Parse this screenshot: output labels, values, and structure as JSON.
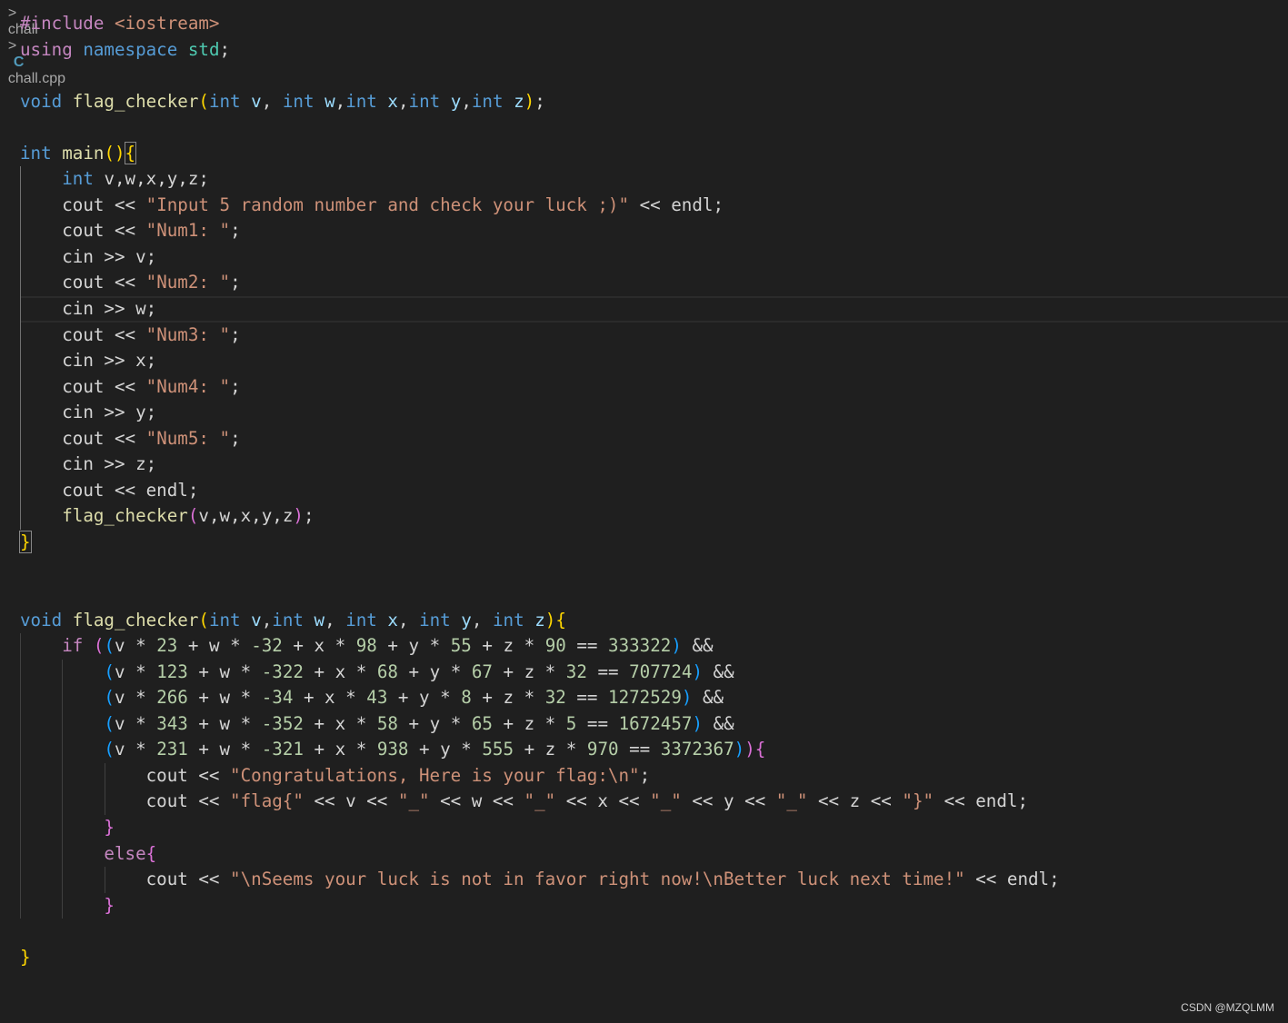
{
  "breadcrumb": {
    "folder": "chall",
    "separator": ">",
    "file": "chall.cpp"
  },
  "code": {
    "lines": [
      [
        {
          "t": "#include ",
          "c": "k-pp"
        },
        {
          "t": "<iostream>",
          "c": "str"
        }
      ],
      [
        {
          "t": "using ",
          "c": "k-purple"
        },
        {
          "t": "namespace ",
          "c": "k-blue"
        },
        {
          "t": "std",
          "c": "ty"
        },
        {
          "t": ";",
          "c": "txt"
        }
      ],
      [],
      [
        {
          "t": "void ",
          "c": "k-blue"
        },
        {
          "t": "flag_checker",
          "c": "fn"
        },
        {
          "t": "(",
          "c": "b1"
        },
        {
          "t": "int ",
          "c": "k-blue"
        },
        {
          "t": "v",
          "c": "var"
        },
        {
          "t": ", ",
          "c": "txt"
        },
        {
          "t": "int ",
          "c": "k-blue"
        },
        {
          "t": "w",
          "c": "var"
        },
        {
          "t": ",",
          "c": "txt"
        },
        {
          "t": "int ",
          "c": "k-blue"
        },
        {
          "t": "x",
          "c": "var"
        },
        {
          "t": ",",
          "c": "txt"
        },
        {
          "t": "int ",
          "c": "k-blue"
        },
        {
          "t": "y",
          "c": "var"
        },
        {
          "t": ",",
          "c": "txt"
        },
        {
          "t": "int ",
          "c": "k-blue"
        },
        {
          "t": "z",
          "c": "var"
        },
        {
          "t": ")",
          "c": "b1"
        },
        {
          "t": ";",
          "c": "txt"
        }
      ],
      [],
      [
        {
          "t": "int ",
          "c": "k-blue"
        },
        {
          "t": "main",
          "c": "fn"
        },
        {
          "t": "()",
          "c": "b1"
        },
        {
          "t": "{",
          "c": "b1 bm"
        }
      ],
      [
        {
          "t": "    "
        },
        {
          "t": "int ",
          "c": "k-blue"
        },
        {
          "t": "v,w,x,y,z;",
          "c": "txt"
        }
      ],
      [
        {
          "t": "    "
        },
        {
          "t": "cout ",
          "c": "txt"
        },
        {
          "t": "<< ",
          "c": "txt"
        },
        {
          "t": "\"Input 5 random number and check your luck ;)\"",
          "c": "str"
        },
        {
          "t": " << endl;",
          "c": "txt"
        }
      ],
      [
        {
          "t": "    "
        },
        {
          "t": "cout ",
          "c": "txt"
        },
        {
          "t": "<< ",
          "c": "txt"
        },
        {
          "t": "\"Num1: \"",
          "c": "str"
        },
        {
          "t": ";",
          "c": "txt"
        }
      ],
      [
        {
          "t": "    "
        },
        {
          "t": "cin >> v;",
          "c": "txt"
        }
      ],
      [
        {
          "t": "    "
        },
        {
          "t": "cout ",
          "c": "txt"
        },
        {
          "t": "<< ",
          "c": "txt"
        },
        {
          "t": "\"Num2: \"",
          "c": "str"
        },
        {
          "t": ";",
          "c": "txt"
        }
      ],
      [
        {
          "t": "    "
        },
        {
          "t": "cin >> w;",
          "c": "txt"
        }
      ],
      [
        {
          "t": "    "
        },
        {
          "t": "cout ",
          "c": "txt"
        },
        {
          "t": "<< ",
          "c": "txt"
        },
        {
          "t": "\"Num3: \"",
          "c": "str"
        },
        {
          "t": ";",
          "c": "txt"
        }
      ],
      [
        {
          "t": "    "
        },
        {
          "t": "cin >> x;",
          "c": "txt"
        }
      ],
      [
        {
          "t": "    "
        },
        {
          "t": "cout ",
          "c": "txt"
        },
        {
          "t": "<< ",
          "c": "txt"
        },
        {
          "t": "\"Num4: \"",
          "c": "str"
        },
        {
          "t": ";",
          "c": "txt"
        }
      ],
      [
        {
          "t": "    "
        },
        {
          "t": "cin >> y;",
          "c": "txt"
        }
      ],
      [
        {
          "t": "    "
        },
        {
          "t": "cout ",
          "c": "txt"
        },
        {
          "t": "<< ",
          "c": "txt"
        },
        {
          "t": "\"Num5: \"",
          "c": "str"
        },
        {
          "t": ";",
          "c": "txt"
        }
      ],
      [
        {
          "t": "    "
        },
        {
          "t": "cin >> z;",
          "c": "txt"
        }
      ],
      [
        {
          "t": "    "
        },
        {
          "t": "cout << endl;",
          "c": "txt"
        }
      ],
      [
        {
          "t": "    "
        },
        {
          "t": "flag_checker",
          "c": "fn"
        },
        {
          "t": "(",
          "c": "b2"
        },
        {
          "t": "v,w,x,y,z",
          "c": "txt"
        },
        {
          "t": ")",
          "c": "b2"
        },
        {
          "t": ";",
          "c": "txt"
        }
      ],
      [
        {
          "t": "}",
          "c": "b1 bm"
        }
      ],
      [],
      [],
      [
        {
          "t": "void ",
          "c": "k-blue"
        },
        {
          "t": "flag_checker",
          "c": "fn"
        },
        {
          "t": "(",
          "c": "b1"
        },
        {
          "t": "int ",
          "c": "k-blue"
        },
        {
          "t": "v",
          "c": "var"
        },
        {
          "t": ",",
          "c": "txt"
        },
        {
          "t": "int ",
          "c": "k-blue"
        },
        {
          "t": "w",
          "c": "var"
        },
        {
          "t": ", ",
          "c": "txt"
        },
        {
          "t": "int ",
          "c": "k-blue"
        },
        {
          "t": "x",
          "c": "var"
        },
        {
          "t": ", ",
          "c": "txt"
        },
        {
          "t": "int ",
          "c": "k-blue"
        },
        {
          "t": "y",
          "c": "var"
        },
        {
          "t": ", ",
          "c": "txt"
        },
        {
          "t": "int ",
          "c": "k-blue"
        },
        {
          "t": "z",
          "c": "var"
        },
        {
          "t": ")",
          "c": "b1"
        },
        {
          "t": "{",
          "c": "b1"
        }
      ],
      [
        {
          "t": "    "
        },
        {
          "t": "if ",
          "c": "k-purple"
        },
        {
          "t": "(",
          "c": "b2"
        },
        {
          "t": "(",
          "c": "b3"
        },
        {
          "t": "v * ",
          "c": "txt"
        },
        {
          "t": "23",
          "c": "num"
        },
        {
          "t": " + w * ",
          "c": "txt"
        },
        {
          "t": "-32",
          "c": "num"
        },
        {
          "t": " + x * ",
          "c": "txt"
        },
        {
          "t": "98",
          "c": "num"
        },
        {
          "t": " + y * ",
          "c": "txt"
        },
        {
          "t": "55",
          "c": "num"
        },
        {
          "t": " + z * ",
          "c": "txt"
        },
        {
          "t": "90",
          "c": "num"
        },
        {
          "t": " == ",
          "c": "txt"
        },
        {
          "t": "333322",
          "c": "num"
        },
        {
          "t": ")",
          "c": "b3"
        },
        {
          "t": " &&",
          "c": "txt"
        }
      ],
      [
        {
          "t": "        "
        },
        {
          "t": "(",
          "c": "b3"
        },
        {
          "t": "v * ",
          "c": "txt"
        },
        {
          "t": "123",
          "c": "num"
        },
        {
          "t": " + w * ",
          "c": "txt"
        },
        {
          "t": "-322",
          "c": "num"
        },
        {
          "t": " + x * ",
          "c": "txt"
        },
        {
          "t": "68",
          "c": "num"
        },
        {
          "t": " + y * ",
          "c": "txt"
        },
        {
          "t": "67",
          "c": "num"
        },
        {
          "t": " + z * ",
          "c": "txt"
        },
        {
          "t": "32",
          "c": "num"
        },
        {
          "t": " == ",
          "c": "txt"
        },
        {
          "t": "707724",
          "c": "num"
        },
        {
          "t": ")",
          "c": "b3"
        },
        {
          "t": " &&",
          "c": "txt"
        }
      ],
      [
        {
          "t": "        "
        },
        {
          "t": "(",
          "c": "b3"
        },
        {
          "t": "v * ",
          "c": "txt"
        },
        {
          "t": "266",
          "c": "num"
        },
        {
          "t": " + w * ",
          "c": "txt"
        },
        {
          "t": "-34",
          "c": "num"
        },
        {
          "t": " + x * ",
          "c": "txt"
        },
        {
          "t": "43",
          "c": "num"
        },
        {
          "t": " + y * ",
          "c": "txt"
        },
        {
          "t": "8",
          "c": "num"
        },
        {
          "t": " + z * ",
          "c": "txt"
        },
        {
          "t": "32",
          "c": "num"
        },
        {
          "t": " == ",
          "c": "txt"
        },
        {
          "t": "1272529",
          "c": "num"
        },
        {
          "t": ")",
          "c": "b3"
        },
        {
          "t": " &&",
          "c": "txt"
        }
      ],
      [
        {
          "t": "        "
        },
        {
          "t": "(",
          "c": "b3"
        },
        {
          "t": "v * ",
          "c": "txt"
        },
        {
          "t": "343",
          "c": "num"
        },
        {
          "t": " + w * ",
          "c": "txt"
        },
        {
          "t": "-352",
          "c": "num"
        },
        {
          "t": " + x * ",
          "c": "txt"
        },
        {
          "t": "58",
          "c": "num"
        },
        {
          "t": " + y * ",
          "c": "txt"
        },
        {
          "t": "65",
          "c": "num"
        },
        {
          "t": " + z * ",
          "c": "txt"
        },
        {
          "t": "5",
          "c": "num"
        },
        {
          "t": " == ",
          "c": "txt"
        },
        {
          "t": "1672457",
          "c": "num"
        },
        {
          "t": ")",
          "c": "b3"
        },
        {
          "t": " &&",
          "c": "txt"
        }
      ],
      [
        {
          "t": "        "
        },
        {
          "t": "(",
          "c": "b3"
        },
        {
          "t": "v * ",
          "c": "txt"
        },
        {
          "t": "231",
          "c": "num"
        },
        {
          "t": " + w * ",
          "c": "txt"
        },
        {
          "t": "-321",
          "c": "num"
        },
        {
          "t": " + x * ",
          "c": "txt"
        },
        {
          "t": "938",
          "c": "num"
        },
        {
          "t": " + y * ",
          "c": "txt"
        },
        {
          "t": "555",
          "c": "num"
        },
        {
          "t": " + z * ",
          "c": "txt"
        },
        {
          "t": "970",
          "c": "num"
        },
        {
          "t": " == ",
          "c": "txt"
        },
        {
          "t": "3372367",
          "c": "num"
        },
        {
          "t": ")",
          "c": "b3"
        },
        {
          "t": ")",
          "c": "b2"
        },
        {
          "t": "{",
          "c": "b2"
        }
      ],
      [
        {
          "t": "            "
        },
        {
          "t": "cout << ",
          "c": "txt"
        },
        {
          "t": "\"Congratulations, Here is your flag:\\n\"",
          "c": "str"
        },
        {
          "t": ";",
          "c": "txt"
        }
      ],
      [
        {
          "t": "            "
        },
        {
          "t": "cout << ",
          "c": "txt"
        },
        {
          "t": "\"flag{\"",
          "c": "str"
        },
        {
          "t": " << v << ",
          "c": "txt"
        },
        {
          "t": "\"_\"",
          "c": "str"
        },
        {
          "t": " << w << ",
          "c": "txt"
        },
        {
          "t": "\"_\"",
          "c": "str"
        },
        {
          "t": " << x << ",
          "c": "txt"
        },
        {
          "t": "\"_\"",
          "c": "str"
        },
        {
          "t": " << y << ",
          "c": "txt"
        },
        {
          "t": "\"_\"",
          "c": "str"
        },
        {
          "t": " << z << ",
          "c": "txt"
        },
        {
          "t": "\"}\"",
          "c": "str"
        },
        {
          "t": " << endl;",
          "c": "txt"
        }
      ],
      [
        {
          "t": "        "
        },
        {
          "t": "}",
          "c": "b2"
        }
      ],
      [
        {
          "t": "        "
        },
        {
          "t": "else",
          "c": "k-purple"
        },
        {
          "t": "{",
          "c": "b2"
        }
      ],
      [
        {
          "t": "            "
        },
        {
          "t": "cout << ",
          "c": "txt"
        },
        {
          "t": "\"\\nSeems your luck is not in favor right now!\\nBetter luck next time!\"",
          "c": "str"
        },
        {
          "t": " << endl;",
          "c": "txt"
        }
      ],
      [
        {
          "t": "        "
        },
        {
          "t": "}",
          "c": "b2"
        }
      ],
      [],
      [
        {
          "t": "}",
          "c": "b1"
        }
      ]
    ]
  },
  "watermark": "CSDN @MZQLMM"
}
